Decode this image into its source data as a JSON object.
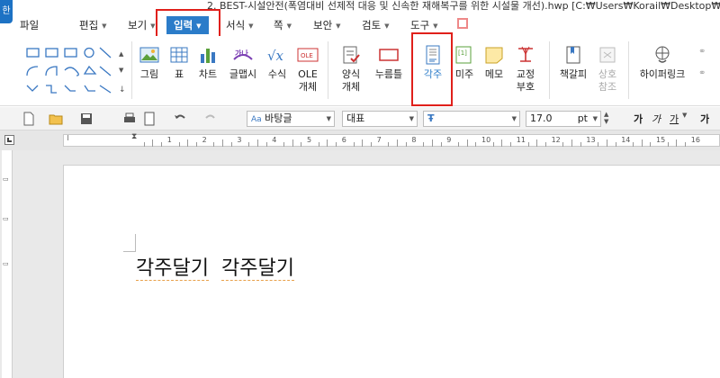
{
  "window": {
    "app_icon": "한",
    "title": "2. BEST-시설안전(폭염대비 선제적 대응 및 신속한 재해복구를 위한 시설물 개선).hwp [C:₩Users₩Korail₩Desktop₩"
  },
  "menu": {
    "items": [
      {
        "label": "파일",
        "has_arrow": false
      },
      {
        "label": "편집",
        "has_arrow": true
      },
      {
        "label": "보기",
        "has_arrow": true
      },
      {
        "label": "입력",
        "has_arrow": true,
        "active": true
      },
      {
        "label": "서식",
        "has_arrow": true
      },
      {
        "label": "쪽",
        "has_arrow": true
      },
      {
        "label": "보안",
        "has_arrow": true
      },
      {
        "label": "검토",
        "has_arrow": true
      },
      {
        "label": "도구",
        "has_arrow": true
      }
    ]
  },
  "ribbon": {
    "picture": "그림",
    "table": "표",
    "chart": "차트",
    "wordart": "글맵시",
    "equation": "수식",
    "ole_1": "OLE",
    "ole_2": "개체",
    "form_1": "양식",
    "form_2": "개체",
    "pushpin": "누름틀",
    "footnote": "각주",
    "endnote": "미주",
    "memo": "메모",
    "proof_1": "교정",
    "proof_2": "부호",
    "bookmark": "책갈피",
    "crossref_1": "상호",
    "crossref_2": "참조",
    "hyperlink": "하이퍼링크"
  },
  "format_toolbar": {
    "style": "바탕글",
    "font_lang": "대표",
    "font_name": "",
    "font_size": "17.0",
    "size_unit": "pt",
    "bold": "가",
    "italic": "가",
    "underline": "가"
  },
  "ruler": {
    "ticks": [
      "1",
      "2",
      "3",
      "4",
      "5",
      "6",
      "7",
      "8",
      "9",
      "10",
      "11",
      "12",
      "13",
      "14",
      "15",
      "16"
    ]
  },
  "document": {
    "text_1": "각주달기",
    "text_2": "각주달기"
  },
  "colors": {
    "active_menu": "#2b7cc9",
    "highlight": "#e0201b",
    "spell_underline": "#e8a04a"
  }
}
